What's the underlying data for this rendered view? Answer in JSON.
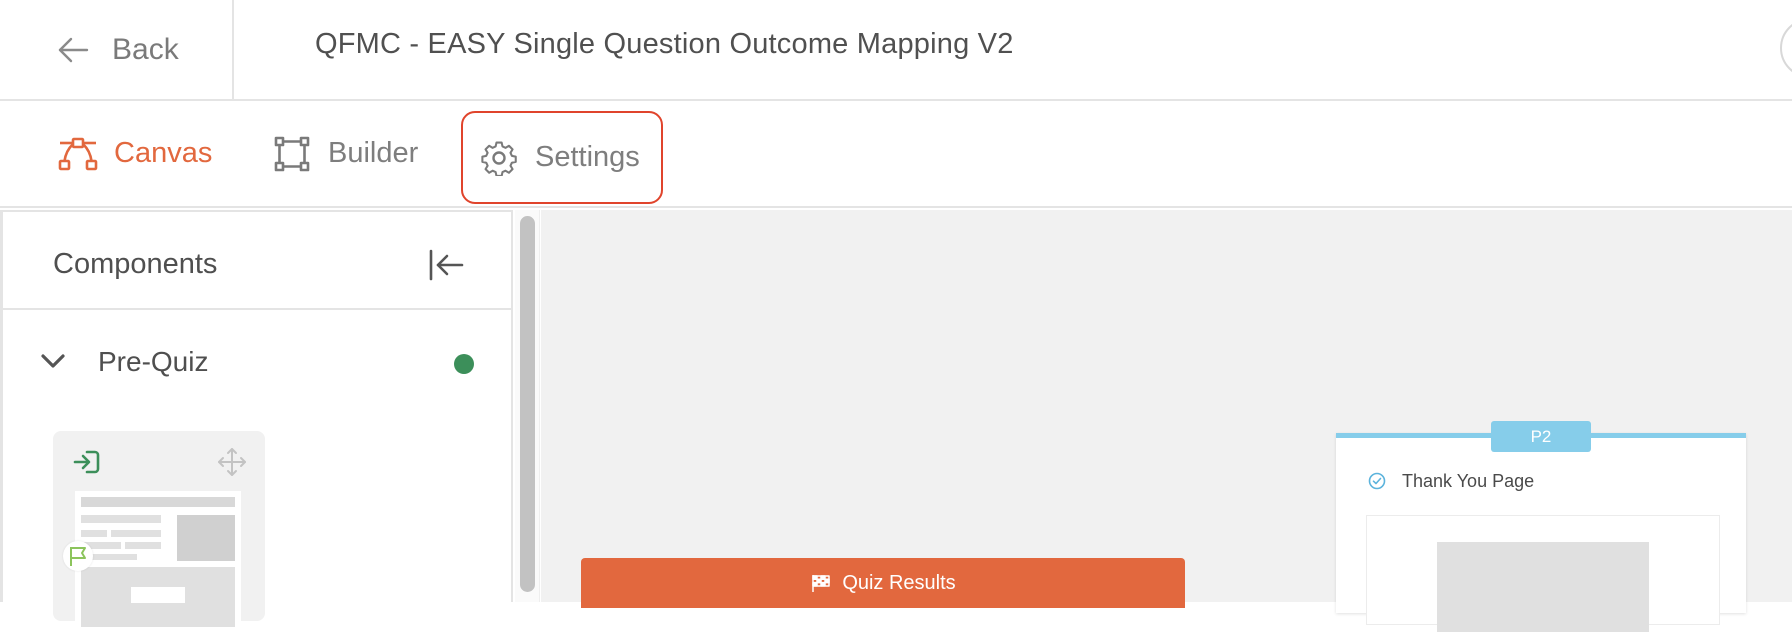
{
  "topbar": {
    "back_label": "Back",
    "title": "QFMC - EASY Single Question Outcome Mapping V2"
  },
  "tabs": {
    "canvas": "Canvas",
    "builder": "Builder",
    "settings": "Settings",
    "active": "canvas",
    "accent_color": "#e2683e",
    "highlight_color": "#e0442c"
  },
  "sidebar": {
    "title": "Components",
    "sections": [
      {
        "label": "Pre-Quiz",
        "status_color": "#3c8f5a",
        "expanded": true
      }
    ]
  },
  "canvas": {
    "quiz_results_label": "Quiz Results",
    "page_card": {
      "badge": "P2",
      "label": "Thank You Page",
      "accent_color": "#86cdea"
    }
  }
}
